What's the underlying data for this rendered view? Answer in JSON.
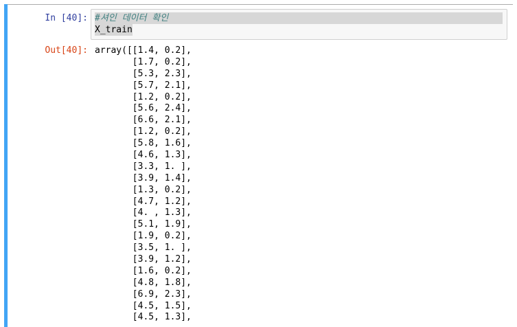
{
  "input_cell": {
    "prompt": "In [40]:",
    "comment": "#셔인 데이터 확인",
    "code": "X_train"
  },
  "output_cell": {
    "prompt": "Out[40]:",
    "rows": [
      "array([[1.4, 0.2],",
      "       [1.7, 0.2],",
      "       [5.3, 2.3],",
      "       [5.7, 2.1],",
      "       [1.2, 0.2],",
      "       [5.6, 2.4],",
      "       [6.6, 2.1],",
      "       [1.2, 0.2],",
      "       [5.8, 1.6],",
      "       [4.6, 1.3],",
      "       [3.3, 1. ],",
      "       [3.9, 1.4],",
      "       [1.3, 0.2],",
      "       [4.7, 1.2],",
      "       [4. , 1.3],",
      "       [5.1, 1.9],",
      "       [1.9, 0.2],",
      "       [3.5, 1. ],",
      "       [3.9, 1.2],",
      "       [1.6, 0.2],",
      "       [4.8, 1.8],",
      "       [6.9, 2.3],",
      "       [4.5, 1.5],",
      "       [4.5, 1.3],"
    ]
  },
  "colors": {
    "selection_bar": "#42a5f5",
    "in_prompt": "#303f9f",
    "out_prompt": "#d84315",
    "comment": "#408080"
  }
}
